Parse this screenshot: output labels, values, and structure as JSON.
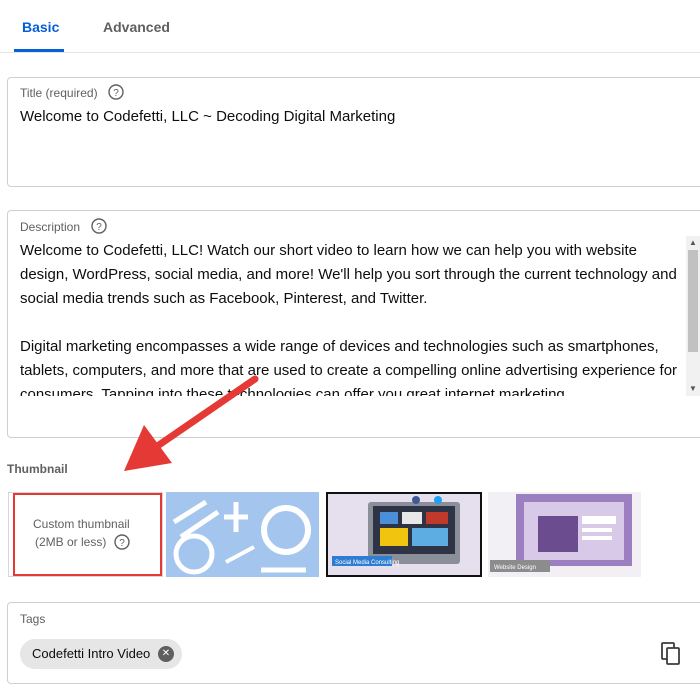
{
  "tabs": [
    {
      "label": "Basic",
      "active": true
    },
    {
      "label": "Advanced",
      "active": false
    }
  ],
  "title_field": {
    "label": "Title (required)",
    "value": "Welcome to Codefetti, LLC ~ Decoding Digital Marketing"
  },
  "description_field": {
    "label": "Description",
    "paragraph1": "Welcome to Codefetti, LLC! Watch our short video to learn how we can help you with website design,  WordPress, social media, and more! We'll help you sort through the current technology and social media trends such as Facebook, Pinterest, and Twitter.",
    "paragraph2": "Digital marketing encompasses a wide range of devices and technologies such as smartphones, tablets, computers, and more that are used to create a compelling online advertising experience for consumers. Tapping into these technologies can offer you great internet marketing"
  },
  "thumbnail": {
    "heading": "Thumbnail",
    "custom_line1": "Custom thumbnail",
    "custom_line2": "(2MB or less)",
    "options": [
      {
        "label": ""
      },
      {
        "label": "Social Media Consulting"
      },
      {
        "label": "Website Design"
      }
    ]
  },
  "tags_field": {
    "label": "Tags",
    "tags": [
      "Codefetti Intro Video"
    ]
  },
  "colors": {
    "accent": "#065fd4",
    "annotation_red": "#e53935"
  },
  "icons": [
    "help-circle-icon",
    "close-circle-icon",
    "copy-icon",
    "arrow-annotation"
  ]
}
